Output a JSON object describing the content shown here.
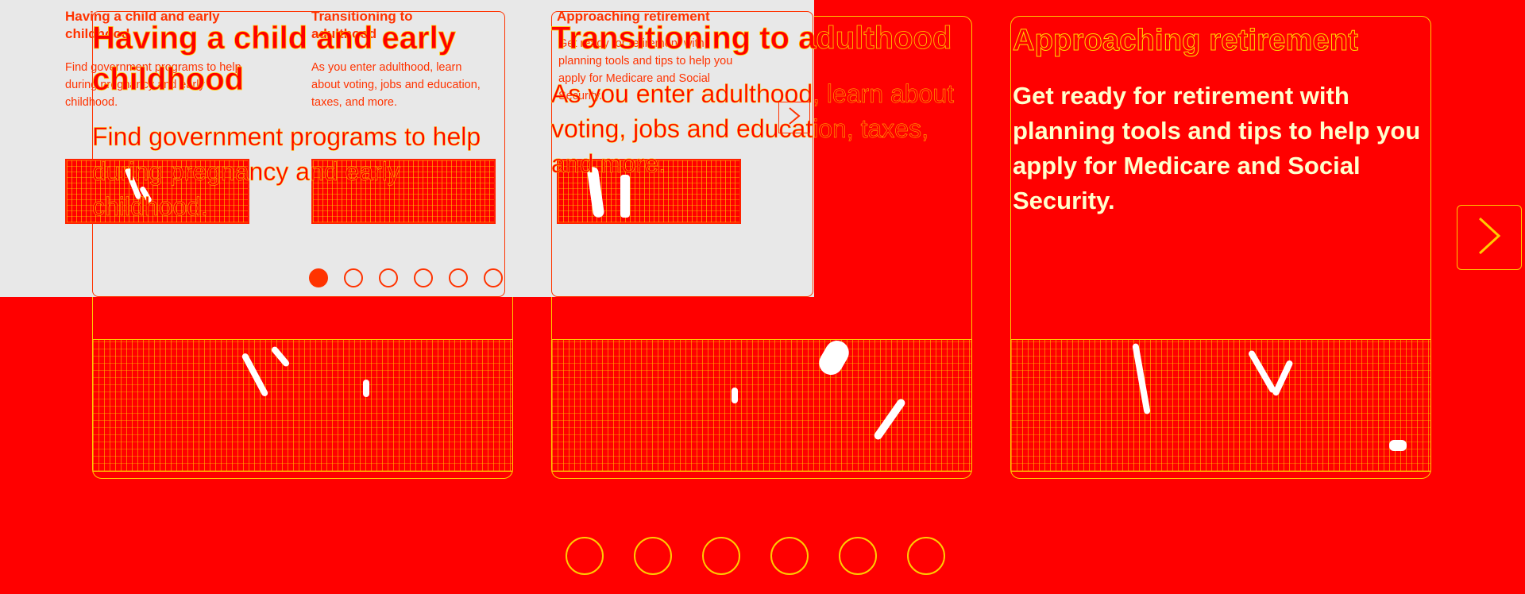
{
  "colors": {
    "background": "#ff0000",
    "outline": "#ffcc00",
    "overlay_background": "#e8e8e8",
    "overlay_accent": "#ff3300"
  },
  "carousel_large": {
    "cards": [
      {
        "title": "Having a child and early childhood",
        "description": "Find government programs to help during pregnancy and early childhood."
      },
      {
        "title": "Transitioning to adulthood",
        "description": "As you enter adulthood, learn about voting, jobs and education, taxes, and more."
      },
      {
        "title": "Approaching retirement",
        "description": "Get ready for retirement with planning tools and tips to help you apply for Medicare and Social Security."
      }
    ],
    "next_icon": "chevron-right-icon",
    "dot_count": 6
  },
  "carousel_small": {
    "cards": [
      {
        "title": "Having a child and early childhood",
        "description": "Find government programs to help during pregnancy and early childhood."
      },
      {
        "title": "Transitioning to adulthood",
        "description": "As you enter adulthood, learn about voting, jobs and education, taxes, and more."
      },
      {
        "title": "Approaching retirement",
        "description": "Get ready for retirement with planning tools and tips to help you apply for Medicare and Social Security."
      }
    ],
    "next_icon": "chevron-right-icon",
    "active_dot": 1,
    "dot_count": 6
  }
}
